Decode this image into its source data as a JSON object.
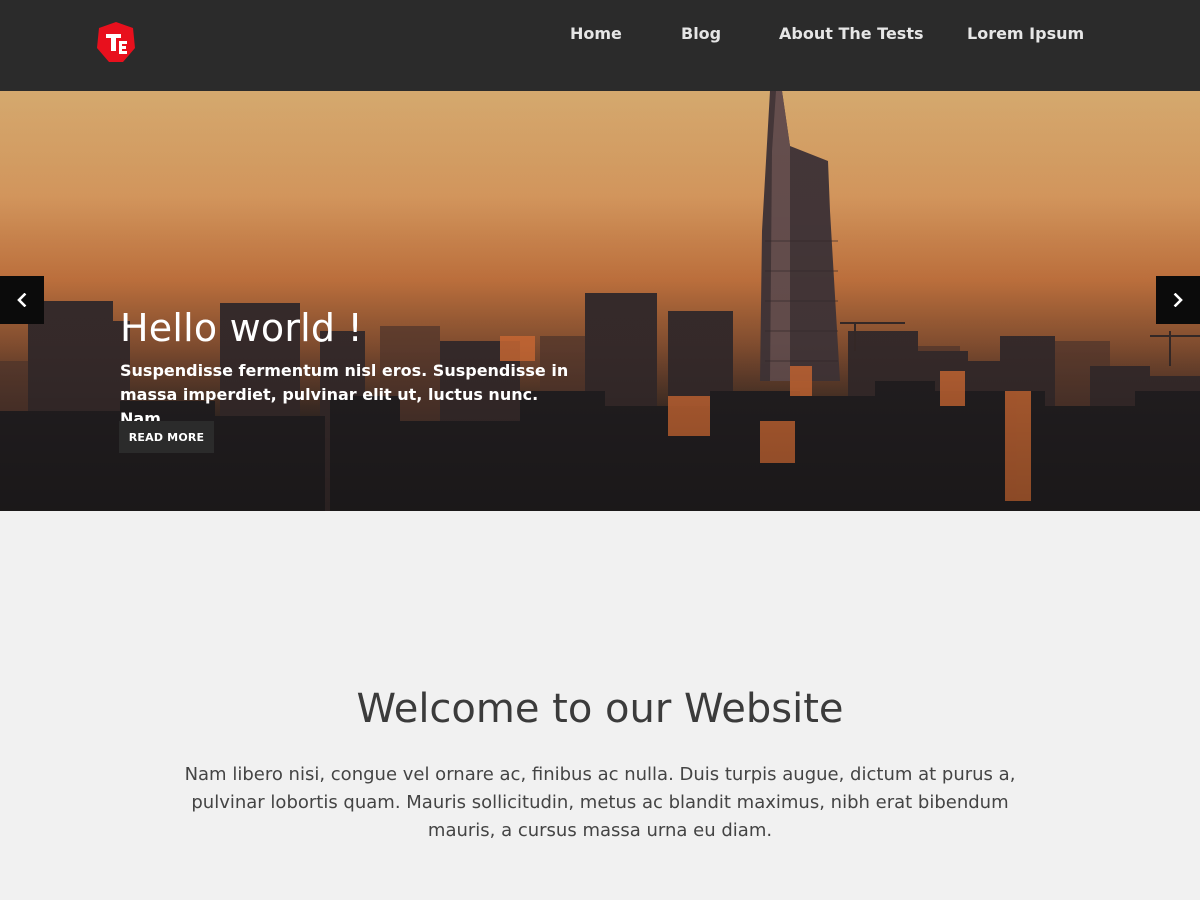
{
  "header": {
    "logo_icon": "shield-te-logo",
    "nav": [
      {
        "label": "Home"
      },
      {
        "label": "Blog"
      },
      {
        "label": "About The Tests"
      },
      {
        "label": "Lorem Ipsum"
      }
    ]
  },
  "hero": {
    "title": "Hello world !",
    "text": "Suspendisse fermentum nisl eros. Suspendisse in massa imperdiet, pulvinar elit ut, luctus nunc. Nam",
    "button_label": "READ MORE",
    "prev_icon": "chevron-left-icon",
    "next_icon": "chevron-right-icon"
  },
  "welcome": {
    "title": "Welcome to our Website",
    "text": "Nam libero nisi, congue vel ornare ac, finibus ac nulla. Duis turpis augue, dictum at purus a, pulvinar lobortis quam. Mauris sollicitudin, metus ac blandit maximus, nibh erat bibendum mauris, a cursus massa urna eu diam."
  },
  "colors": {
    "header_bg": "#2b2b2b",
    "logo_red": "#e8101d",
    "page_bg": "#f1f1f1"
  }
}
